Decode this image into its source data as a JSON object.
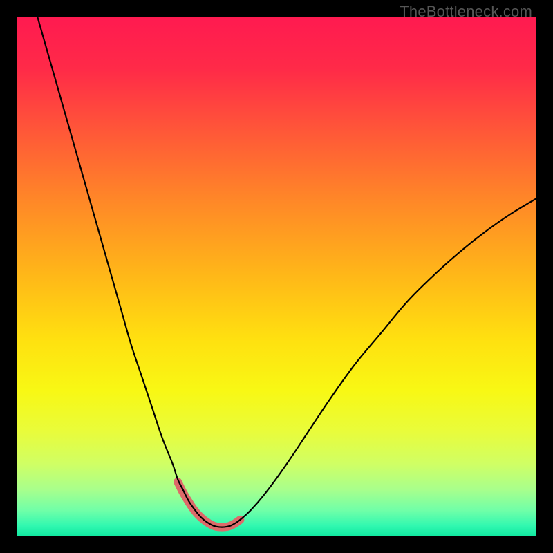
{
  "watermark": "TheBottleneck.com",
  "gradient": {
    "stops": [
      {
        "offset": 0.0,
        "color": "#ff1a50"
      },
      {
        "offset": 0.1,
        "color": "#ff2a48"
      },
      {
        "offset": 0.22,
        "color": "#ff5738"
      },
      {
        "offset": 0.35,
        "color": "#ff8628"
      },
      {
        "offset": 0.5,
        "color": "#ffb818"
      },
      {
        "offset": 0.62,
        "color": "#ffe010"
      },
      {
        "offset": 0.72,
        "color": "#f8f814"
      },
      {
        "offset": 0.8,
        "color": "#e8fc3c"
      },
      {
        "offset": 0.86,
        "color": "#d0ff64"
      },
      {
        "offset": 0.91,
        "color": "#a8ff8c"
      },
      {
        "offset": 0.95,
        "color": "#70ffa8"
      },
      {
        "offset": 0.98,
        "color": "#30f8b0"
      },
      {
        "offset": 1.0,
        "color": "#10e8a0"
      }
    ]
  },
  "chart_data": {
    "type": "line",
    "title": "",
    "xlabel": "",
    "ylabel": "",
    "xlim": [
      0,
      100
    ],
    "ylim": [
      0,
      100
    ],
    "series": [
      {
        "name": "main-curve",
        "x": [
          4,
          6,
          8,
          10,
          12,
          14,
          16,
          18,
          20,
          22,
          24,
          26,
          28,
          30,
          31,
          32,
          33,
          34,
          35,
          36,
          37,
          38,
          39,
          40,
          41,
          42,
          43,
          45,
          48,
          52,
          56,
          60,
          65,
          70,
          75,
          80,
          85,
          90,
          95,
          100
        ],
        "y": [
          100,
          93,
          86,
          79,
          72,
          65,
          58,
          51,
          44,
          37,
          31,
          25,
          19,
          14,
          11,
          9,
          7,
          5.5,
          4.2,
          3.2,
          2.5,
          2.0,
          1.8,
          1.8,
          2.0,
          2.5,
          3.2,
          5.0,
          8.5,
          14,
          20,
          26,
          33,
          39,
          45,
          50,
          54.5,
          58.5,
          62,
          65
        ]
      },
      {
        "name": "highlight-band",
        "x": [
          31,
          32,
          33,
          34,
          35,
          36,
          37,
          38,
          39,
          40,
          41,
          42,
          43
        ],
        "y": [
          10.5,
          8.5,
          6.8,
          5.3,
          4.1,
          3.2,
          2.5,
          2.0,
          1.8,
          1.8,
          2.0,
          2.5,
          3.2
        ]
      }
    ]
  },
  "styles": {
    "main_curve": {
      "stroke": "#000000",
      "width": 2.2
    },
    "highlight": {
      "stroke": "#dd6a6a",
      "width": 12
    }
  }
}
